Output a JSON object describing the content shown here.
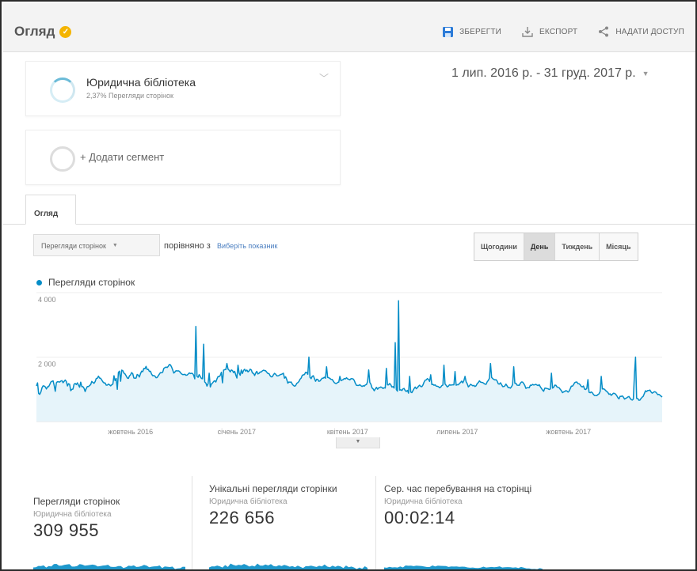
{
  "header": {
    "title": "Огляд",
    "actions": [
      {
        "label": "ЗБЕРЕГТИ",
        "icon": "save-icon"
      },
      {
        "label": "ЕКСПОРТ",
        "icon": "export-icon"
      },
      {
        "label": "НАДАТИ ДОСТУП",
        "icon": "share-icon"
      }
    ],
    "badge_color": "#f4b400"
  },
  "segments": [
    {
      "name": "Юридична бібліотека",
      "subtitle": "2,37% Перегляди сторінок"
    },
    {
      "name": "+ Додати сегмент"
    }
  ],
  "date_range": "1 лип. 2016 р. - 31 груд. 2017 р.",
  "tabs": [
    "Огляд"
  ],
  "controls": {
    "metric": "Перегляди сторінок",
    "compare_text": "порівняно з",
    "pick_metric": "Виберіть показник",
    "granularity": [
      "Щогодини",
      "День",
      "Тиждень",
      "Місяць"
    ],
    "active_granularity": "День"
  },
  "colors": {
    "accent": "#058dc7",
    "fill": "#e6f4fa"
  },
  "chart_data": {
    "type": "area",
    "title": "",
    "series": [
      {
        "name": "Перегляди сторінок",
        "values": [
          1105,
          1200,
          872,
          844,
          916,
          1045,
          1107,
          1101,
          1076,
          1011,
          1078,
          1083,
          1148,
          1226,
          1246,
          1265,
          1121,
          938,
          1205,
          1238,
          1232,
          1224,
          1256,
          1268,
          1206,
          1249,
          1288,
          1238,
          1104,
          1175,
          1156,
          958,
          998,
          1006,
          1158,
          1183,
          1146,
          1199,
          1132,
          1065,
          1222,
          1081,
          1082,
          1034,
          931,
          1024,
          1087,
          1085,
          1117,
          1146,
          1245,
          1212,
          1186,
          1236,
          1335,
          1342,
          1408,
          1349,
          1341,
          1288,
          1232,
          1198,
          1197,
          1128,
          1130,
          1162,
          1139,
          1107,
          1138,
          1162,
          1210,
          1268,
          1335,
          1443,
          1525,
          1562,
          1605,
          1596,
          1576,
          1501,
          1474,
          1417,
          1351,
          1337,
          1419,
          1445,
          1518,
          1484,
          1352,
          1342,
          1349,
          1460,
          1439,
          1381,
          1488,
          1562,
          1545,
          1646,
          1637,
          1711,
          1614,
          1619,
          1553,
          1560,
          1471,
          1420,
          1428,
          1408,
          1359,
          1364,
          1419,
          1471,
          1520,
          1512,
          1530,
          1647,
          1672,
          1690,
          1675,
          1712,
          1769,
          1759,
          1694,
          1602,
          1504,
          1537,
          1577,
          1568,
          1576,
          1560,
          1519,
          1479,
          1458,
          1457,
          1466,
          1436,
          1440,
          1473,
          1508,
          1487,
          1496,
          1486,
          1437,
          1324,
          1412,
          1400,
          1373,
          1456,
          1397,
          1337,
          1327,
          1272,
          1228,
          1195,
          1099,
          1172,
          1143,
          1072,
          1164,
          1196,
          1241,
          1266,
          1224,
          1320,
          1396,
          1392,
          1434,
          1529,
          1571,
          1595,
          1611,
          1613,
          1594,
          1626,
          1593,
          1540,
          1599,
          1583,
          1517,
          1559,
          1444,
          1349,
          1457,
          1505,
          1435,
          1422,
          1489,
          1585,
          1621,
          1560,
          1597,
          1542,
          1571,
          1624,
          1601,
          1506,
          1492,
          1428,
          1504,
          1555,
          1478,
          1494,
          1536,
          1536,
          1571,
          1593,
          1582,
          1573,
          1531,
          1491,
          1488,
          1424,
          1386,
          1390,
          1451,
          1495,
          1469,
          1421,
          1416,
          1429,
          1453,
          1462,
          1477,
          1417,
          1345,
          1390,
          1305,
          1191,
          1227,
          1220,
          1226,
          1162,
          1122,
          1097,
          1112,
          1183,
          1204,
          1241,
          1314,
          1347,
          1433,
          1448,
          1457,
          1527,
          1523,
          1465,
          1417,
          1368,
          1329,
          1404,
          1422,
          1334,
          1249,
          1313,
          1307,
          1249,
          1257,
          1300,
          1343,
          1348,
          1374,
          1346,
          1351,
          1367,
          1360,
          1337,
          1311,
          1309,
          1258,
          1206,
          1186,
          1181,
          1215,
          1222,
          1242,
          1267,
          1286,
          1302,
          1335,
          1323,
          1359,
          1323,
          1311,
          1294,
          1327,
          1330,
          1320,
          1274,
          1183,
          1121,
          1118,
          1118,
          1143,
          1111,
          1088,
          1112,
          1098,
          1135,
          1147,
          1239,
          1272,
          1212,
          1155,
          1042,
          1014,
          955,
          1013,
          1059,
          1003,
          1045,
          1052,
          1073,
          1056,
          1025,
          1049,
          1037,
          1079,
          1139,
          1138,
          1180,
          1141,
          1071,
          1084,
          1039,
          1022,
          990,
          942,
          1025,
          975,
          983,
          961,
          1014,
          1025,
          959,
          933,
          966,
          882,
          866,
          916,
          896,
          960,
          1024,
          1070,
          1019,
          1053,
          1095,
          1130,
          1086,
          1083,
          1134,
          1223,
          1283,
          1291,
          1333,
          1305,
          1244,
          1198,
          1148,
          1154,
          1124,
          1138,
          1097,
          1094,
          1082,
          1047,
          1068,
          1114,
          1134,
          1168,
          1162,
          1123,
          1075,
          1096,
          1142,
          1130,
          1134,
          1141,
          1139,
          1120,
          1127,
          1144,
          1141,
          1181,
          1212,
          1253,
          1200,
          1271,
          1246,
          1235,
          1174,
          1075,
          1108,
          1156,
          1134,
          1108,
          1121,
          1088,
          1110,
          1179,
          1209,
          1263,
          1224,
          1215,
          1211,
          1183,
          1161,
          1157,
          1233,
          1276,
          1343,
          1380,
          1373,
          1331,
          1308,
          1290,
          1298,
          1253,
          1168,
          1161,
          1202,
          1144,
          1082,
          1084,
          1106,
          1163,
          1110,
          1052,
          1054,
          1036,
          1079,
          1146,
          1160,
          1187,
          1188,
          1128,
          1126,
          1122,
          1191,
          1226,
          1224,
          1180,
          1120,
          1029,
          1050,
          1049,
          1047,
          1129,
          1120,
          1154,
          1134,
          1142,
          1153,
          1132,
          1117,
          1144,
          1077,
          1026,
          976,
          937,
          1034,
          1035,
          1024,
          1016,
          993,
          1011,
          1001,
          1038,
          1059,
          1128,
          1126,
          1075,
          1059,
          1049,
          999,
          956,
          896,
          920,
          929,
          960,
          944,
          913,
          940,
          1017,
          1097,
          1097,
          1141,
          1205,
          1222,
          1226,
          1175,
          1173,
          1141,
          1086,
          1076,
          1102,
          1003,
          993,
          1031,
          969,
          905,
          893,
          918,
          893,
          839,
          807,
          807,
          804,
          838,
          859,
          931,
          1010,
          1011,
          1016,
          1000,
          959,
          932,
          901,
          843,
          859,
          813,
          843,
          879,
          870,
          849,
          803,
          739,
          705,
          783,
          780,
          794,
          758,
          696,
          718,
          733,
          762,
          779,
          724,
          684,
          664,
          695,
          740,
          729,
          718,
          714,
          659,
          665,
          720,
          756,
          785,
          874,
          954,
          931,
          962,
          961,
          977,
          918,
          882,
          902,
          924,
          917,
          884,
          835,
          843,
          819,
          787,
          760
        ],
        "spikes": [
          [
            70,
            1420
          ],
          [
            73,
            1000
          ],
          [
            76,
            1250
          ],
          [
            144,
            2950
          ],
          [
            151,
            2400
          ],
          [
            156,
            1500
          ],
          [
            168,
            1200
          ],
          [
            172,
            1800
          ],
          [
            182,
            1750
          ],
          [
            185,
            1600
          ],
          [
            223,
            1500
          ],
          [
            246,
            2000
          ],
          [
            262,
            1700
          ],
          [
            274,
            1400
          ],
          [
            300,
            1600
          ],
          [
            316,
            1650
          ],
          [
            324,
            2450
          ],
          [
            327,
            3750
          ],
          [
            337,
            1400
          ],
          [
            356,
            1450
          ],
          [
            368,
            1750
          ],
          [
            378,
            1550
          ],
          [
            387,
            1400
          ],
          [
            410,
            1800
          ],
          [
            431,
            1700
          ],
          [
            465,
            1500
          ],
          [
            498,
            1300
          ],
          [
            510,
            1400
          ],
          [
            540,
            1450
          ],
          [
            541,
            2000
          ],
          [
            568,
            2000
          ],
          [
            610,
            1200
          ],
          [
            640,
            1100
          ],
          [
            660,
            1350
          ],
          [
            683,
            1200
          ],
          [
            715,
            1150
          ],
          [
            730,
            1300
          ],
          [
            751,
            1200
          ],
          [
            755,
            1050
          ],
          [
            768,
            1100
          ],
          [
            779,
            1150
          ],
          [
            796,
            1080
          ],
          [
            797,
            1350
          ],
          [
            814,
            1250
          ],
          [
            828,
            1500
          ],
          [
            836,
            2450
          ],
          [
            837,
            1900
          ],
          [
            845,
            1650
          ],
          [
            852,
            1500
          ],
          [
            860,
            1150
          ],
          [
            876,
            1550
          ],
          [
            890,
            1180
          ],
          [
            914,
            1350
          ],
          [
            924,
            1100
          ],
          [
            930,
            1250
          ],
          [
            942,
            1420
          ],
          [
            956,
            1250
          ],
          [
            972,
            1250
          ],
          [
            996,
            1200
          ],
          [
            1022,
            1450
          ],
          [
            1046,
            1500
          ],
          [
            1058,
            1100
          ]
        ]
      }
    ],
    "xlabel": "",
    "ylabel": "",
    "ylim": [
      0,
      4000
    ],
    "y_ticks": [
      "4 000",
      "2 000"
    ],
    "x_ticks": [
      "жовтень 2016",
      "січень 2017",
      "квітень 2017",
      "липень 2017",
      "жовтень 2017"
    ],
    "grid": true,
    "legend": "top-left"
  },
  "expand_glyph": "▼",
  "scorecards": [
    {
      "title": "Перегляди сторінок",
      "segment": "Юридична бібліотека",
      "value": "309 955"
    },
    {
      "title": "Унікальні перегляди сторінки",
      "segment": "Юридична бібліотека",
      "value": "226 656"
    },
    {
      "title": "Сер. час перебування на сторінці",
      "segment": "Юридична бібліотека",
      "value": "00:02:14"
    }
  ]
}
